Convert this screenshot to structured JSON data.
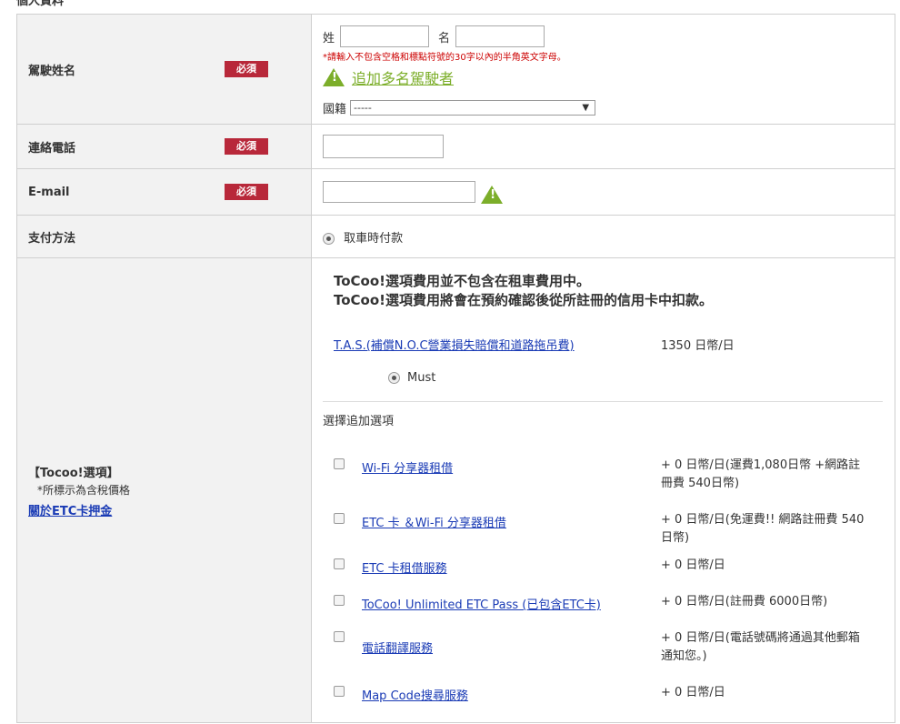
{
  "section_title": "個人資料",
  "required_badge": "必須",
  "driver": {
    "label": "駕駛姓名",
    "surname_label": "姓",
    "given_label": "名",
    "surname_value": "",
    "given_value": "",
    "note": "*請輸入不包含空格和標點符號的30字以內的半角英文字母。",
    "add_driver": "追加多名駕駛者",
    "nationality_label": "國籍",
    "nationality_selected": "-----"
  },
  "phone": {
    "label": "連絡電話",
    "value": ""
  },
  "email": {
    "label": "E-mail",
    "value": ""
  },
  "payment": {
    "label": "支付方法",
    "option": "取車時付款"
  },
  "options": {
    "label": "【Tocoo!選項】",
    "tax_note": "*所標示為含稅價格",
    "etc_link": "關於ETC卡押金",
    "intro_line1": "ToCoo!選項費用並不包含在租車費用中。",
    "intro_line2": "ToCoo!選項費用將會在預約確認後從所註冊的信用卡中扣款。",
    "tas_link": "T.A.S.(補償N.O.C營業損失賠償和道路拖吊費)",
    "tas_price": "1350 日幣/日",
    "must_label": "Must",
    "choose_label": "選擇追加選項",
    "items": [
      {
        "name": "Wi-Fi 分享器租借",
        "price": "+ 0 日幣/日(運費1,080日幣 +網路註冊費 540日幣)"
      },
      {
        "name": "ETC 卡 ＆Wi-Fi 分享器租借",
        "price": "+ 0 日幣/日(免運費!! 網路註冊費 540日幣)"
      },
      {
        "name": "ETC 卡租借服務",
        "price": "+ 0 日幣/日"
      },
      {
        "name": "ToCoo! Unlimited ETC Pass (已包含ETC卡)",
        "price": "+ 0 日幣/日(註冊費 6000日幣)"
      },
      {
        "name": "電話翻譯服務",
        "price": "+ 0 日幣/日(電話號碼將通過其他郵箱通知您。)"
      },
      {
        "name": "Map Code搜尋服務",
        "price": "+ 0 日幣/日"
      }
    ]
  },
  "colors": {
    "required": "#b8283a",
    "warning": "#7cae2a",
    "link": "#1a3bb5",
    "note": "#cc0000"
  }
}
